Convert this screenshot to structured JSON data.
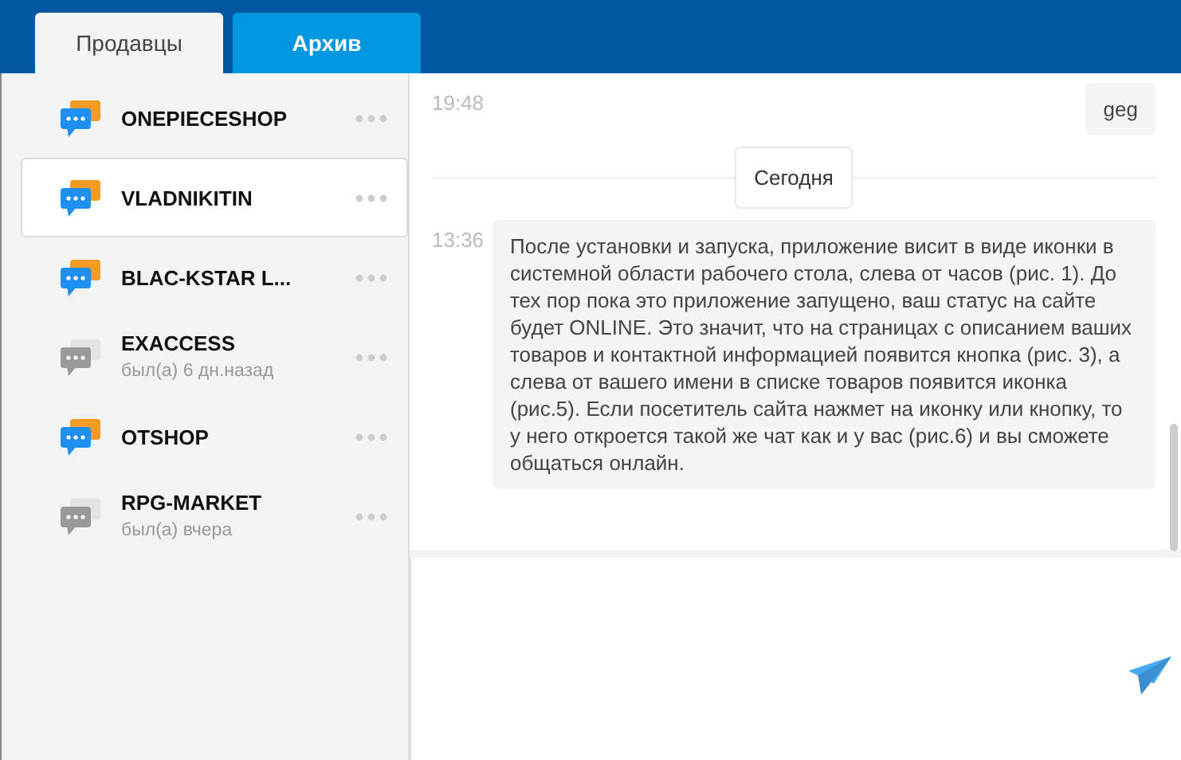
{
  "tabs": [
    {
      "label": "Продавцы",
      "selected": true
    },
    {
      "label": "Архив",
      "selected": false
    }
  ],
  "sellers": [
    {
      "name": "ONEPIECESHOP",
      "online": true,
      "selected": false
    },
    {
      "name": "VLADNIKITIN",
      "online": true,
      "selected": true
    },
    {
      "name": "BLAC-KSTAR L...",
      "online": true,
      "selected": false
    },
    {
      "name": "EXACCESS",
      "online": false,
      "status": "был(а) 6 дн.назад",
      "selected": false
    },
    {
      "name": "OTSHOP",
      "online": true,
      "selected": false
    },
    {
      "name": "RPG-MARKET",
      "online": false,
      "status": "был(а) вчера",
      "selected": false
    }
  ],
  "messages": [
    {
      "kind": "message",
      "time": "19:48",
      "text": "geg",
      "outgoing": true
    },
    {
      "kind": "divider",
      "text": "Сегодня"
    },
    {
      "kind": "message",
      "time": "13:36",
      "text": "После установки и запуска, приложение висит в виде иконки в системной области рабочего стола, слева от часов (рис. 1). До тех пор пока это приложение запущено, ваш статус на сайте будет ONLINE. Это значит, что на страницах с описанием ваших товаров и контактной информацией появится кнопка (рис. 3), а слева от вашего имени в списке товаров появится иконка (рис.5). Если посетитель сайта нажмет на иконку или кнопку, то у него откроется такой же чат как и у вас (рис.6) и вы сможете общаться онлайн.",
      "outgoing": false
    }
  ]
}
